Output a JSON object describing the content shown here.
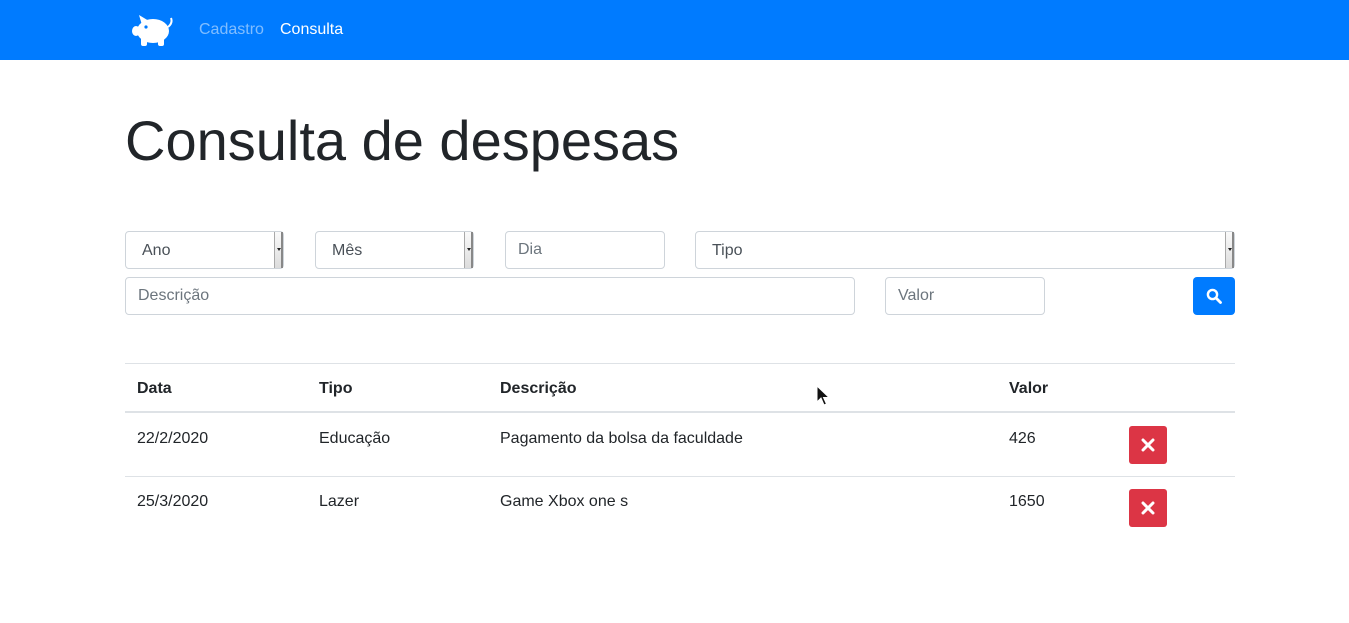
{
  "nav": {
    "logo_icon": "piggy-bank-icon",
    "links": [
      "Cadastro",
      "Consulta"
    ],
    "active": "Consulta"
  },
  "page": {
    "title": "Consulta de despesas"
  },
  "filters": {
    "ano": {
      "selected": "Ano"
    },
    "mes": {
      "selected": "Mês"
    },
    "dia": {
      "placeholder": "Dia"
    },
    "tipo": {
      "selected": "Tipo"
    },
    "descricao": {
      "placeholder": "Descrição"
    },
    "valor": {
      "placeholder": "Valor"
    },
    "search_icon": "search-icon"
  },
  "table": {
    "headers": [
      "Data",
      "Tipo",
      "Descrição",
      "Valor"
    ],
    "rows": [
      {
        "data": "22/2/2020",
        "tipo": "Educação",
        "descricao": "Pagamento da bolsa da faculdade",
        "valor": "426"
      },
      {
        "data": "25/3/2020",
        "tipo": "Lazer",
        "descricao": "Game Xbox one s",
        "valor": "1650"
      }
    ],
    "delete_icon": "close-icon"
  },
  "colors": {
    "primary": "#007bff",
    "danger": "#dc3545",
    "text": "#212529",
    "border": "#dee2e6"
  }
}
